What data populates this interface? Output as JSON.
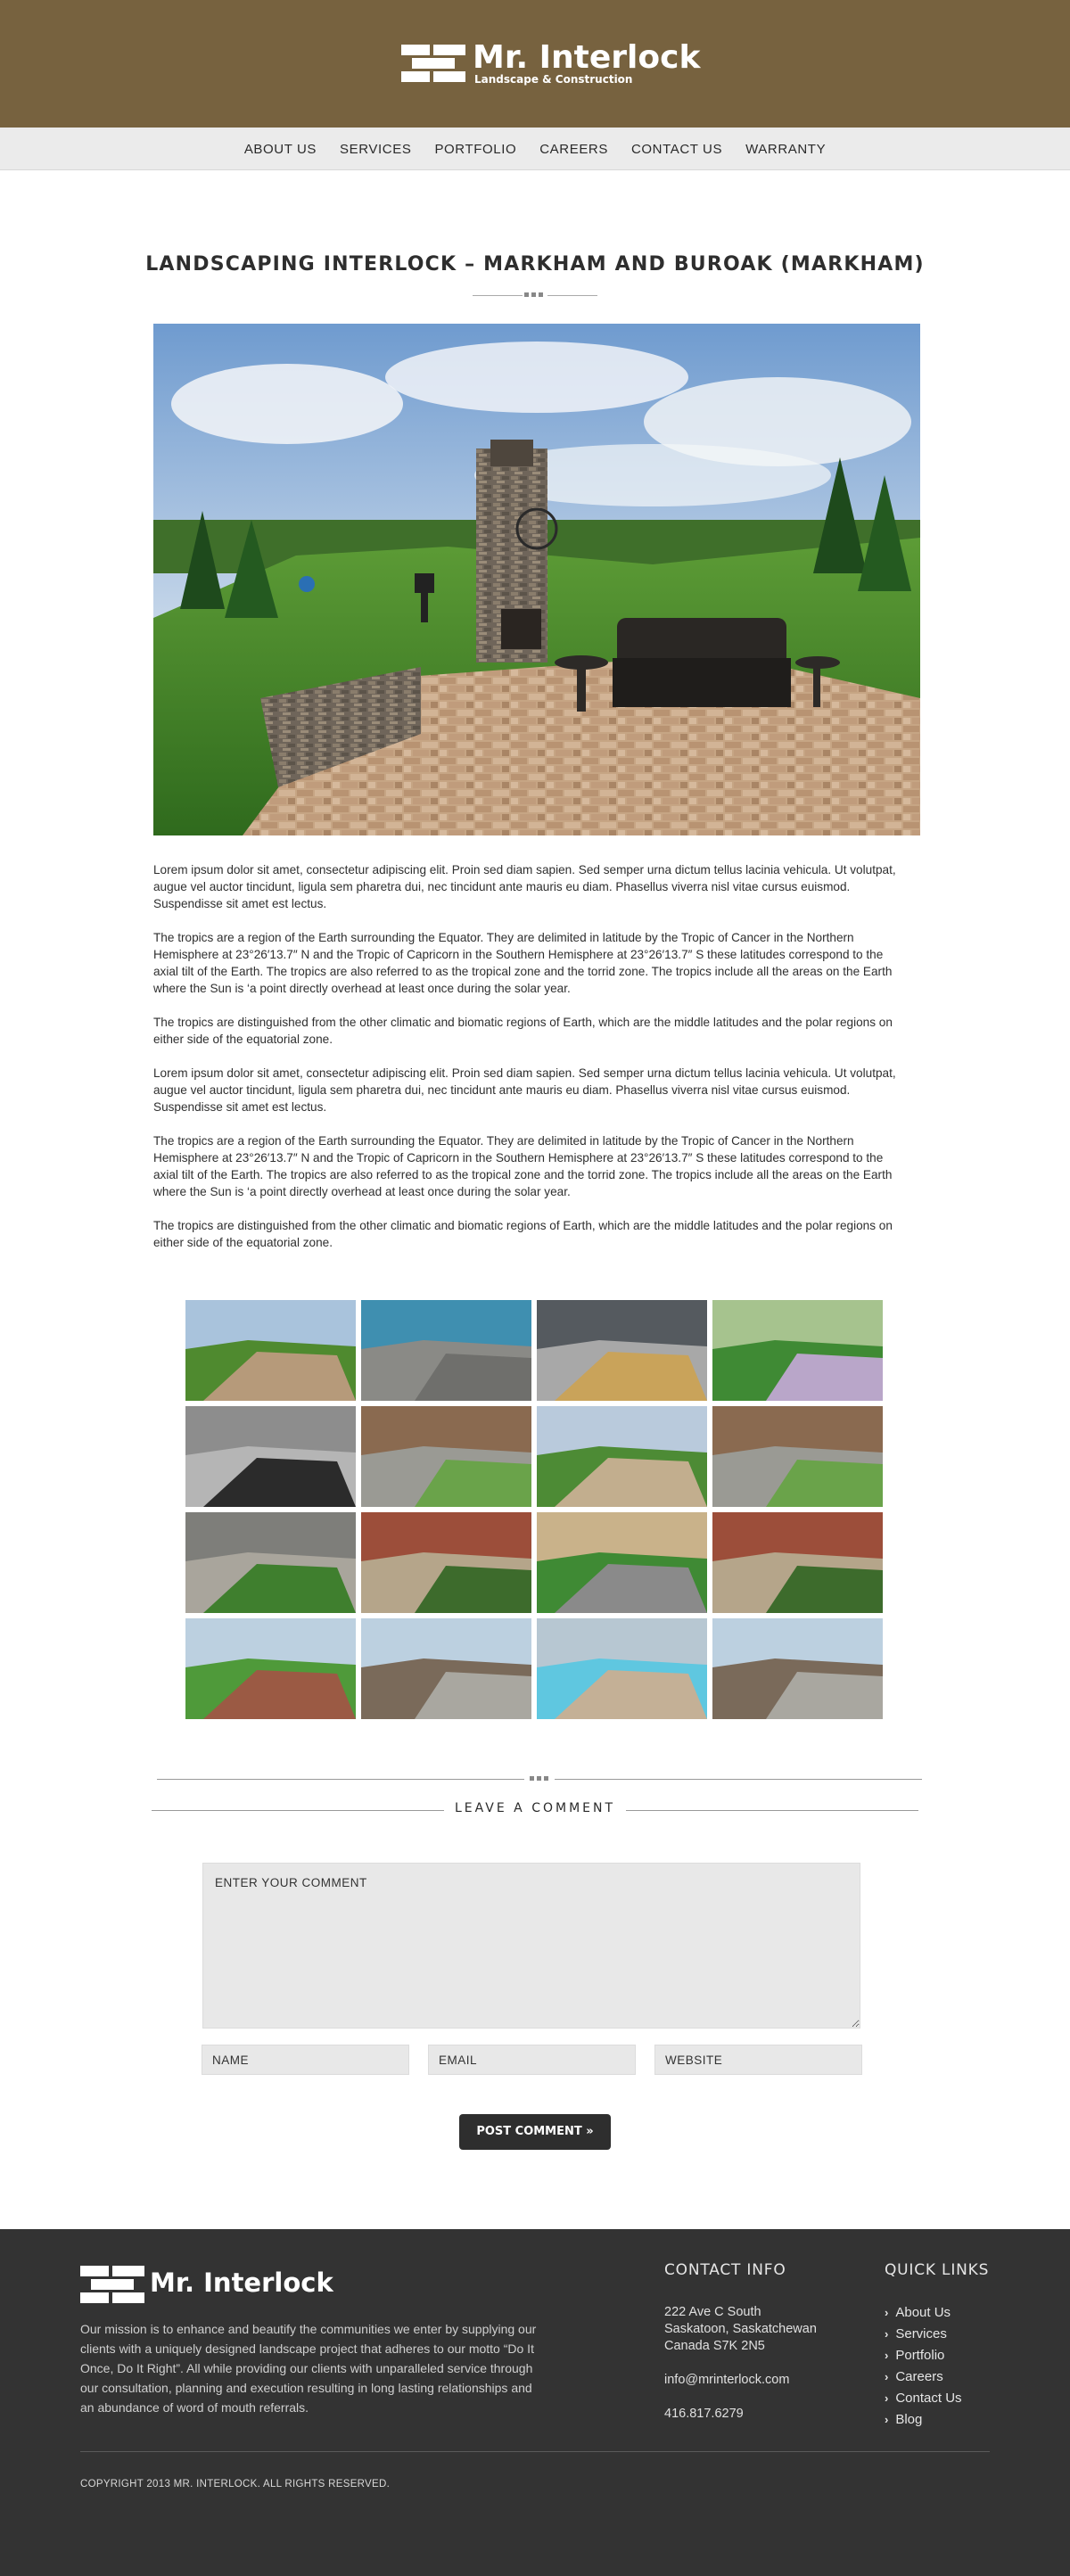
{
  "brand": {
    "name": "Mr. Interlock",
    "tagline": "Landscape & Construction"
  },
  "nav": {
    "items": [
      "ABOUT US",
      "SERVICES",
      "PORTFOLIO",
      "CAREERS",
      "CONTACT US",
      "WARRANTY"
    ]
  },
  "page": {
    "title": "LANDSCAPING INTERLOCK – MARKHAM AND BUROAK (MARKHAM)"
  },
  "article": {
    "paragraphs": [
      "Lorem ipsum dolor sit amet, consectetur adipiscing elit. Proin sed diam sapien. Sed semper urna dictum tellus lacinia vehicula. Ut volutpat, augue vel auctor tincidunt, ligula sem pharetra dui, nec tincidunt ante mauris eu diam. Phasellus viverra nisl vitae cursus euismod. Suspendisse sit amet est lectus.",
      "The tropics are a region of the Earth surrounding the Equator. They are delimited in latitude by the Tropic of Cancer in the Northern Hemisphere at 23°26′13.7″ N and the Tropic of Capricorn in the Southern Hemisphere at 23°26′13.7″ S these latitudes correspond to the axial tilt of the Earth. The tropics are also referred to as the tropical zone and the torrid zone. The tropics include all the areas on the Earth where the Sun is ‘a point directly overhead at least once during the solar year.",
      "The tropics are distinguished from the other climatic and biomatic regions of Earth, which are the middle latitudes and the polar regions on either side of the equatorial zone.",
      "Lorem ipsum dolor sit amet, consectetur adipiscing elit. Proin sed diam sapien. Sed semper urna dictum tellus lacinia vehicula. Ut volutpat, augue vel auctor tincidunt, ligula sem pharetra dui, nec tincidunt ante mauris eu diam. Phasellus viverra nisl vitae cursus euismod. Suspendisse sit amet est lectus.",
      "The tropics are a region of the Earth surrounding the Equator. They are delimited in latitude by the Tropic of Cancer in the Northern Hemisphere at 23°26′13.7″ N and the Tropic of Capricorn in the Southern Hemisphere at 23°26′13.7″ S these latitudes correspond to the axial tilt of the Earth. The tropics are also referred to as the tropical zone and the torrid zone. The tropics include all the areas on the Earth where the Sun is ‘a point directly overhead at least once during the solar year.",
      "The tropics are distinguished from the other climatic and biomatic regions of Earth, which are the middle latitudes and the polar regions on either side of the equatorial zone."
    ]
  },
  "gallery": {
    "thumbs": [
      {
        "theme": "patio-fireplace",
        "colors": [
          "#a9c3dc",
          "#4f8a2f",
          "#b69a7a"
        ]
      },
      {
        "theme": "pool-edge-pavers",
        "colors": [
          "#3f8fb0",
          "#8a8a86",
          "#6f6f6c"
        ]
      },
      {
        "theme": "patio-chairs",
        "colors": [
          "#555a5f",
          "#a8a8a8",
          "#c9a35a"
        ]
      },
      {
        "theme": "garden-lawn",
        "colors": [
          "#a6c38e",
          "#3f8a34",
          "#b9a6c9"
        ]
      },
      {
        "theme": "paver-closeup",
        "colors": [
          "#8d8d8d",
          "#b5b5b5",
          "#2b2b2b"
        ]
      },
      {
        "theme": "front-steps",
        "colors": [
          "#8a6a50",
          "#9a9a94",
          "#6aa34a"
        ]
      },
      {
        "theme": "garden-path",
        "colors": [
          "#b9cadc",
          "#4d8b35",
          "#c2ae8e"
        ]
      },
      {
        "theme": "front-steps-2",
        "colors": [
          "#8a6a50",
          "#9a9a94",
          "#6aa34a"
        ]
      },
      {
        "theme": "driveway-border",
        "colors": [
          "#7e7e7a",
          "#a9a59c",
          "#3f7f2e"
        ]
      },
      {
        "theme": "side-path",
        "colors": [
          "#9c4e3a",
          "#b5a58a",
          "#3d6b2c"
        ]
      },
      {
        "theme": "backyard-lawn",
        "colors": [
          "#c9b28a",
          "#3f8a34",
          "#8a8a8a"
        ]
      },
      {
        "theme": "side-path-2",
        "colors": [
          "#9c4e3a",
          "#b5a58a",
          "#3d6b2c"
        ]
      },
      {
        "theme": "brick-house-yard",
        "colors": [
          "#bcd0e0",
          "#4f9a3a",
          "#9b5a44"
        ]
      },
      {
        "theme": "house-driveway",
        "colors": [
          "#bcd0e0",
          "#7a6a5a",
          "#a9a7a0"
        ]
      },
      {
        "theme": "pool-deck",
        "colors": [
          "#b7c7d2",
          "#5fc7e0",
          "#c4b096"
        ]
      },
      {
        "theme": "house-driveway-2",
        "colors": [
          "#bcd0e0",
          "#7a6a5a",
          "#a9a7a0"
        ]
      }
    ]
  },
  "comment_form": {
    "heading": "LEAVE A COMMENT",
    "comment_placeholder": "ENTER YOUR COMMENT",
    "name_placeholder": "NAME",
    "email_placeholder": "EMAIL",
    "website_placeholder": "WEBSITE",
    "submit_label": "POST COMMENT »"
  },
  "footer": {
    "mission": "Our mission is to enhance and beautify the communities we enter by supplying our clients with a uniquely designed landscape project that adheres to our motto “Do It Once, Do It Right”. All while providing our clients with unparalleled service through our consultation, planning and execution resulting in long lasting relationships and an abundance of word of mouth referrals.",
    "contact_heading": "CONTACT INFO",
    "address_line1": "222 Ave C South",
    "address_line2": "Saskatoon, Saskatchewan",
    "address_line3": "Canada S7K 2N5",
    "email": "info@mrinterlock.com",
    "phone": "416.817.6279",
    "links_heading": "QUICK LINKS",
    "links": [
      "About Us",
      "Services",
      "Portfolio",
      "Careers",
      "Contact Us",
      "Blog"
    ],
    "copyright": "COPYRIGHT 2013 MR. INTERLOCK. ALL RIGHTS RESERVED."
  },
  "colors": {
    "header_bg": "#77623f",
    "nav_bg": "#ebebeb",
    "footer_bg": "#333333",
    "button_bg": "#2e2e2e"
  },
  "icons": {
    "logo": "interlock-bricks-logo",
    "link_bullet": "chevron-right-icon"
  }
}
